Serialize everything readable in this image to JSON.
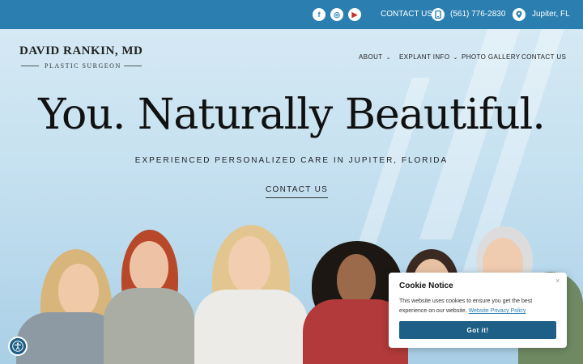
{
  "topbar": {
    "social": [
      {
        "name": "facebook",
        "glyph": "f"
      },
      {
        "name": "instagram",
        "glyph": "◎"
      },
      {
        "name": "youtube",
        "glyph": "▶"
      }
    ],
    "contact_label": "CONTACT US",
    "phone": "(561) 776-2830",
    "location": "Jupiter, FL",
    "bg_color": "#2a7fb0"
  },
  "logo": {
    "name": "DAVID RANKIN, MD",
    "subtitle": "PLASTIC SURGEON"
  },
  "nav": {
    "items": [
      {
        "label": "ABOUT",
        "dropdown": true
      },
      {
        "label": "EXPLANT INFO",
        "dropdown": true
      },
      {
        "label": "PHOTO GALLERY",
        "dropdown": false
      },
      {
        "label": "CONTACT US",
        "dropdown": false
      }
    ],
    "chevron": "⌄"
  },
  "hero": {
    "headline": "You. Naturally Beautiful.",
    "tagline": "EXPERIENCED PERSONALIZED CARE IN JUPITER, FLORIDA",
    "cta_label": "CONTACT US"
  },
  "cookie": {
    "close": "×",
    "title": "Cookie Notice",
    "text": "This website uses cookies to ensure you get the best experience on our website.",
    "link_label": "Website Privacy Policy",
    "button_label": "Got it!",
    "button_color": "#1d5f86"
  }
}
